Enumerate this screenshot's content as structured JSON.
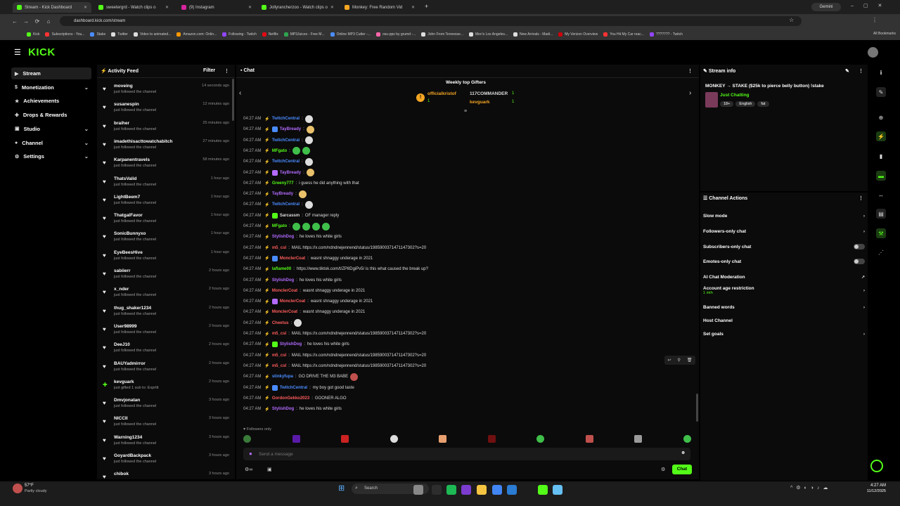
{
  "browser": {
    "tabs": [
      {
        "label": "Stream - Kick Dashboard",
        "fav": "#53fc18"
      },
      {
        "label": "sweetergrd - Watch clips o",
        "fav": "#53fc18"
      },
      {
        "label": "(9) Instagram",
        "fav": "#d6249f"
      },
      {
        "label": "Jollyrancherzoo - Watch clips o",
        "fav": "#53fc18"
      },
      {
        "label": "Monkey: Free Random Vid",
        "fav": "#f5a623"
      }
    ],
    "url": "dashboard.kick.com/stream",
    "gemini_label": "Gemini",
    "bookmarks": [
      "Kick",
      "Subscriptions - You...",
      "Stake",
      "Twitter",
      "Video to animated...",
      "Amazon.com: Onlin...",
      "Following - Twitch",
      "Netflix",
      "MP3Juices - Free M...",
      "Online MP3 Cutter -...",
      "osu-pps by grumd -...",
      "John From Tennesse...",
      "Men's Los Angeles...",
      "New Arrivals - Madi...",
      "My Verizon Overview",
      "You Hit My Car reac...",
      "??????? - Twitch"
    ],
    "all_bookmarks": "All Bookmarks"
  },
  "brand": {
    "logo": "KICK",
    "accent": "#53fc18"
  },
  "nav": [
    {
      "label": "Stream",
      "icon": "play-icon",
      "chevron": false
    },
    {
      "label": "Monetization",
      "icon": "dollar-icon",
      "chevron": true
    },
    {
      "label": "Achievements",
      "icon": "trophy-icon",
      "chevron": false
    },
    {
      "label": "Drops & Rewards",
      "icon": "gift-icon",
      "chevron": false
    },
    {
      "label": "Studio",
      "icon": "camera-icon",
      "chevron": true
    },
    {
      "label": "Channel",
      "icon": "user-icon",
      "chevron": true
    },
    {
      "label": "Settings",
      "icon": "gear-icon",
      "chevron": true
    }
  ],
  "activity": {
    "title": "Activity Feed",
    "filter": "Filter",
    "items": [
      {
        "name": "moveing",
        "sub": "just followed the channel",
        "time": "14 seconds ago"
      },
      {
        "name": "susanespin",
        "sub": "just followed the channel",
        "time": "12 minutes ago"
      },
      {
        "name": "braiher",
        "sub": "just followed the channel",
        "time": "25 minutes ago"
      },
      {
        "name": "imadethisacttowatchabitch",
        "sub": "just followed the channel",
        "time": "27 minutes ago"
      },
      {
        "name": "Karpanentravels",
        "sub": "just followed the channel",
        "time": "58 minutes ago"
      },
      {
        "name": "ThatsValid",
        "sub": "just followed the channel",
        "time": "1 hour ago"
      },
      {
        "name": "LightBeem7",
        "sub": "just followed the channel",
        "time": "1 hour ago"
      },
      {
        "name": "ThatgalFavor",
        "sub": "just followed the channel",
        "time": "1 hour ago"
      },
      {
        "name": "SonicBunnyxo",
        "sub": "just followed the channel",
        "time": "1 hour ago"
      },
      {
        "name": "EyeBeesHive",
        "sub": "just followed the channel",
        "time": "1 hour ago"
      },
      {
        "name": "sabiierr",
        "sub": "just followed the channel",
        "time": "2 hours ago"
      },
      {
        "name": "x_nder",
        "sub": "just followed the channel",
        "time": "2 hours ago"
      },
      {
        "name": "thug_shaker1234",
        "sub": "just followed the channel",
        "time": "2 hours ago"
      },
      {
        "name": "User98999",
        "sub": "just followed the channel",
        "time": "2 hours ago"
      },
      {
        "name": "DeeJ10",
        "sub": "just followed the channel",
        "time": "2 hours ago"
      },
      {
        "name": "BAUYadmirror",
        "sub": "just followed the channel",
        "time": "2 hours ago"
      },
      {
        "name": "kevguark",
        "sub": "just gifted 1 sub to: Exprttt",
        "time": "2 hours ago"
      },
      {
        "name": "Dmvjonatan",
        "sub": "just followed the channel",
        "time": "3 hours ago"
      },
      {
        "name": "NICCII",
        "sub": "just followed the channel",
        "time": "3 hours ago"
      },
      {
        "name": "Warning1234",
        "sub": "just followed the channel",
        "time": "3 hours ago"
      },
      {
        "name": "GoyardBackpack",
        "sub": "just followed the channel",
        "time": "3 hours ago"
      },
      {
        "name": "chibok",
        "sub": "",
        "time": "3 hours ago"
      }
    ]
  },
  "chat": {
    "title": "Chat",
    "gifters_title": "Weekly top Gifters",
    "gifters": [
      {
        "name": "officialkristof",
        "count": "1"
      },
      {
        "name": "117COMMANDER",
        "count": "1"
      },
      {
        "name": "kevguark",
        "count": "1"
      }
    ],
    "messages": [
      {
        "time": "04:27 AM",
        "user": "TwitchCentral",
        "color": "#4a8cff",
        "text": "",
        "emote": "#ddd"
      },
      {
        "time": "04:27 AM",
        "user": "TayBready",
        "color": "#b36bff",
        "text": "",
        "emote": "#e8c16a"
      },
      {
        "time": "04:27 AM",
        "user": "TwitchCentral",
        "color": "#4a8cff",
        "text": "",
        "emote": "#ddd"
      },
      {
        "time": "04:27 AM",
        "user": "MFgato",
        "color": "#53fc18",
        "text": "",
        "emote": "#3fbf4a"
      },
      {
        "time": "04:27 AM",
        "user": "TwitchCentral",
        "color": "#4a8cff",
        "text": "",
        "emote": "#ddd"
      },
      {
        "time": "04:27 AM",
        "user": "TayBready",
        "color": "#b36bff",
        "text": "",
        "emote": "#e8c16a"
      },
      {
        "time": "04:27 AM",
        "user": "Greeny777",
        "color": "#53fc18",
        "text": "i guess he did anything with that",
        "emote": ""
      },
      {
        "time": "04:27 AM",
        "user": "TayBready",
        "color": "#b36bff",
        "text": "",
        "emote": "#e8c16a"
      },
      {
        "time": "04:27 AM",
        "user": "TwitchCentral",
        "color": "#4a8cff",
        "text": "",
        "emote": "#ddd"
      },
      {
        "time": "04:27 AM",
        "user": "Sarcassm",
        "color": "#dddddd",
        "text": "OF manager reply",
        "emote": ""
      },
      {
        "time": "04:27 AM",
        "user": "MFgato",
        "color": "#53fc18",
        "text": "",
        "emote": "#3fbf4a"
      },
      {
        "time": "04:27 AM",
        "user": "StylishDog",
        "color": "#b36bff",
        "text": "he loves his white girls",
        "emote": ""
      },
      {
        "time": "04:27 AM",
        "user": "m5_csl",
        "color": "#ff5c5c",
        "text": "MAIL https://x.com/ndndnejennend/status/1985900371471147302?s=20",
        "emote": ""
      },
      {
        "time": "04:27 AM",
        "user": "MonclerCoat",
        "color": "#ff5c5c",
        "text": "wasnt shnaggy underage in 2021",
        "emote": ""
      },
      {
        "time": "04:27 AM",
        "user": "laflame00",
        "color": "#53fc18",
        "text": "https://www.tiktok.com/t/ZP8DgiPv5/ is this what caused the break up?",
        "emote": ""
      },
      {
        "time": "04:27 AM",
        "user": "StylishDog",
        "color": "#b36bff",
        "text": "he loves his white girls",
        "emote": ""
      },
      {
        "time": "04:27 AM",
        "user": "MonclerCoat",
        "color": "#ff5c5c",
        "text": "wasnt shnaggy underage in 2021",
        "emote": ""
      },
      {
        "time": "04:27 AM",
        "user": "MonclerCoat",
        "color": "#ff5c5c",
        "text": "wasnt shnaggy underage in 2021",
        "emote": ""
      },
      {
        "time": "04:27 AM",
        "user": "MonclerCoat",
        "color": "#ff5c5c",
        "text": "wasnt shnaggy underage in 2021",
        "emote": ""
      },
      {
        "time": "04:27 AM",
        "user": "Cheetus",
        "color": "#ff5c5c",
        "text": "",
        "emote": "#ddd"
      },
      {
        "time": "04:27 AM",
        "user": "m5_csl",
        "color": "#ff5c5c",
        "text": "MAIL https://x.com/ndndnejennend/status/1985900371471147302?s=20",
        "emote": ""
      },
      {
        "time": "04:27 AM",
        "user": "StylishDog",
        "color": "#b36bff",
        "text": "he loves his white girls",
        "emote": ""
      },
      {
        "time": "04:27 AM",
        "user": "m5_csl",
        "color": "#ff5c5c",
        "text": "MAIL https://x.com/ndndnejennend/status/1985900371471147302?s=20",
        "emote": ""
      },
      {
        "time": "04:27 AM",
        "user": "m5_csl",
        "color": "#ff5c5c",
        "text": "MAIL https://x.com/ndndnejennend/status/1985900371471147302?s=20",
        "emote": ""
      },
      {
        "time": "04:27 AM",
        "user": "stinkyfupa",
        "color": "#4a8cff",
        "text": "GO DRIVE THE M3 BABE",
        "emote": "#c0504d"
      },
      {
        "time": "04:27 AM",
        "user": "TwitchCentral",
        "color": "#4a8cff",
        "text": "my boy got good taste",
        "emote": ""
      },
      {
        "time": "04:27 AM",
        "user": "GordonGekko2023",
        "color": "#ff5c5c",
        "text": "GOONER ALGO",
        "emote": ""
      },
      {
        "time": "04:27 AM",
        "user": "StylishDog",
        "color": "#b36bff",
        "text": "he loves his white girls",
        "emote": ""
      }
    ],
    "followers_only": "Followers only",
    "placeholder": "Send a message",
    "send_label": "Chat"
  },
  "stream_info": {
    "title": "Stream info",
    "stream_title": "MONKEY → STAKE ($25k to pierce belly button) !stake",
    "category": "Just Chatting",
    "tags": [
      "18+",
      "English",
      "fat"
    ]
  },
  "channel_actions": {
    "title": "Channel Actions",
    "items": [
      {
        "label": "Slow mode",
        "control": "chevron",
        "sub": ""
      },
      {
        "label": "Followers-only chat",
        "control": "chevron",
        "sub": ""
      },
      {
        "label": "Subscribers-only chat",
        "control": "toggle",
        "sub": ""
      },
      {
        "label": "Emotes-only chat",
        "control": "toggle",
        "sub": ""
      },
      {
        "label": "AI Chat Moderation",
        "control": "external",
        "sub": ""
      },
      {
        "label": "Account age restriction",
        "control": "chevron",
        "sub": "1 mth"
      },
      {
        "label": "Banned words",
        "control": "chevron",
        "sub": ""
      },
      {
        "label": "Host Channel",
        "control": "none",
        "sub": ""
      },
      {
        "label": "Set goals",
        "control": "chevron",
        "sub": ""
      }
    ]
  },
  "taskbar": {
    "weather_temp": "57°F",
    "weather_desc": "Partly cloudy",
    "search": "Search",
    "time": "4:27 AM",
    "date": "11/12/2025"
  }
}
